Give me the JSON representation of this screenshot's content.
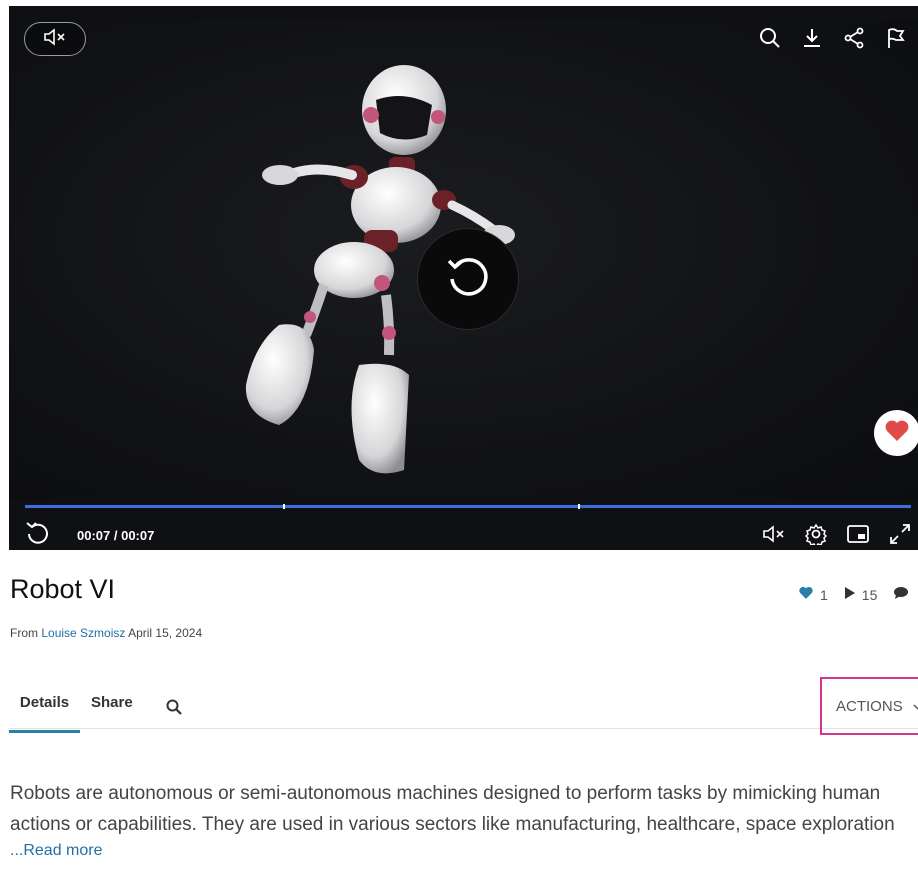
{
  "player": {
    "time": "00:07 / 00:07",
    "progress": 1.0,
    "chapter_marks": [
      0.29,
      0.62
    ],
    "colors": {
      "progress": "#3b6fdc",
      "heart": "#e04a4a"
    },
    "icons": [
      "muted-icon",
      "search-icon",
      "download-icon",
      "share-icon",
      "flag-icon",
      "replay-icon",
      "heart-icon",
      "volume-muted-icon",
      "settings-icon",
      "picture-in-picture-icon",
      "fullscreen-icon"
    ]
  },
  "media": {
    "title": "Robot VI",
    "likes": "1",
    "plays": "15",
    "byline_prefix": "From",
    "author": "Louise Szmoisz",
    "date": "April 15, 2024"
  },
  "tabs": {
    "details": "Details",
    "share": "Share",
    "actions": "ACTIONS"
  },
  "description": {
    "text": "Robots are autonomous or semi-autonomous machines designed to perform tasks by mimicking human actions or capabilities. They are used in various sectors like manufacturing, healthcare, space exploration",
    "read_more": "...Read more"
  }
}
